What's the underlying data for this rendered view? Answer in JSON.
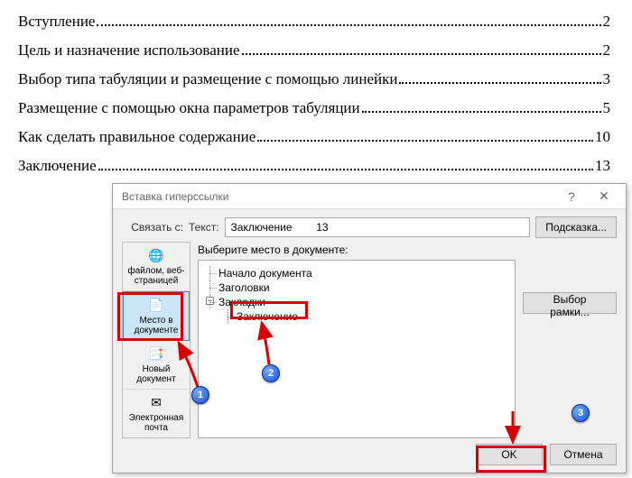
{
  "toc": [
    {
      "title": "Вступление",
      "page": "2"
    },
    {
      "title": "Цель и назначение использование",
      "page": "2"
    },
    {
      "title": "Выбор типа табуляции и размещение с помощью линейки",
      "page": "3"
    },
    {
      "title": "Размещение с помощью окна параметров табуляции",
      "page": "5"
    },
    {
      "title": "Как сделать правильное содержание",
      "page": "10"
    },
    {
      "title": "Заключение",
      "page": "13"
    }
  ],
  "dialog": {
    "title": "Вставка гиперссылки",
    "link_with_label": "Связать с:",
    "text_label": "Текст:",
    "text_value": "Заключение        13",
    "tooltip_btn": "Подсказка...",
    "select_place_label": "Выберите место в документе:",
    "tree": {
      "n1": "Начало документа",
      "n2": "Заголовки",
      "n3": "Закладки",
      "n3_child": "Заключение"
    },
    "frame_btn": "Выбор рамки...",
    "ok": "OK",
    "cancel": "Отмена",
    "linkto": {
      "file": "файлом, веб-страницей",
      "place": "Место в документе",
      "newdoc": "Новый документ",
      "email": "Электронная почта"
    }
  },
  "badges": {
    "b1": "1",
    "b2": "2",
    "b3": "3"
  }
}
